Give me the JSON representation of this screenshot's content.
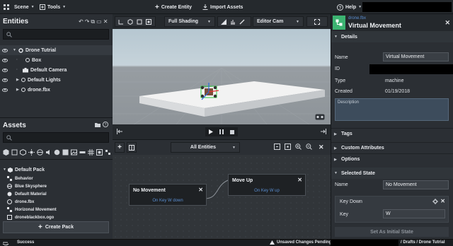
{
  "topbar": {
    "scene_label": "Scene",
    "tools_label": "Tools",
    "create_entity_label": "Create Entity",
    "import_assets_label": "Import Assets",
    "help_label": "Help"
  },
  "entities": {
    "title": "Entities",
    "tree": [
      {
        "label": "Drone Tutrial"
      },
      {
        "label": "Box"
      },
      {
        "label": "Default Camera"
      },
      {
        "label": "Default Lights"
      },
      {
        "label": "drone.fbx"
      }
    ]
  },
  "assets": {
    "title": "Assets",
    "pack_label": "Default Pack",
    "items": [
      {
        "label": "Behavior"
      },
      {
        "label": "Blue Skysphere"
      },
      {
        "label": "Default Material"
      },
      {
        "label": "drone.fbx"
      },
      {
        "label": "Horizonal Movement"
      },
      {
        "label": "droneblackbox.ogo"
      }
    ],
    "create_pack_label": "Create Pack"
  },
  "viewport": {
    "shading_label": "Full Shading",
    "camera_label": "Editor Cam"
  },
  "graph": {
    "filter_label": "All Entities",
    "nodes": [
      {
        "title": "No Movement",
        "trigger": "On Key W down"
      },
      {
        "title": "Move Up",
        "trigger": "On Key W up"
      }
    ]
  },
  "inspector": {
    "asset_type": "drone.fbx",
    "asset_name": "Virtual Movement",
    "details_label": "Details",
    "name_label": "Name",
    "name_value": "Virtual Movement",
    "id_label": "ID",
    "type_label": "Type",
    "type_value": "machine",
    "created_label": "Created",
    "created_value": "01/19/2018",
    "description_placeholder": "Description",
    "tags_label": "Tags",
    "custom_attributes_label": "Custom Attributes",
    "options_label": "Options",
    "selected_state_label": "Selected State",
    "state_name_label": "Name",
    "state_name_value": "No Movement",
    "key_event_label": "Key Down",
    "key_label": "Key",
    "key_value": "W",
    "initial_state_label": "Set As Initial State"
  },
  "status": {
    "left": "Success",
    "unsaved": "Unsaved Changes Pending",
    "breadcrumb": "/ Drafts / Drone Tutrial"
  },
  "colors": {
    "accent_blue": "#5a8ed1",
    "green_logo": "#3cb371",
    "panel_bg": "#2b2f34"
  }
}
